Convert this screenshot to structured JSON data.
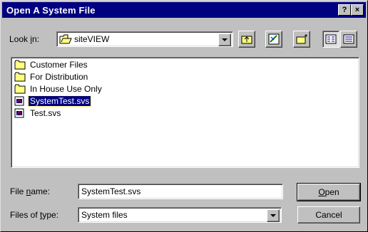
{
  "title": "Open A System File",
  "title_buttons": {
    "help": "?",
    "close": "×"
  },
  "look_in": {
    "label_pre": "Look ",
    "label_u": "i",
    "label_post": "n:",
    "value": "siteVIEW"
  },
  "toolbar": [
    "up-one-level-icon",
    "desktop-icon",
    "new-folder-icon",
    "list-view-icon",
    "details-view-icon"
  ],
  "files": [
    {
      "name": "Customer Files",
      "type": "folder",
      "selected": false
    },
    {
      "name": "For Distribution",
      "type": "folder",
      "selected": false
    },
    {
      "name": "In House Use Only",
      "type": "folder",
      "selected": false
    },
    {
      "name": "SystemTest.svs",
      "type": "system-file",
      "selected": true
    },
    {
      "name": "Test.svs",
      "type": "system-file",
      "selected": false
    }
  ],
  "file_name": {
    "label_pre": "File ",
    "label_u": "n",
    "label_post": "ame:",
    "value": "SystemTest.svs"
  },
  "files_of_type": {
    "label_pre": "Files of ",
    "label_u": "t",
    "label_post": "ype:",
    "value": "System files"
  },
  "buttons": {
    "open_u": "O",
    "open_rest": "pen",
    "cancel": "Cancel"
  },
  "colors": {
    "title_bar": "#000080",
    "dialog": "#c0c0c0",
    "selection": "#000080",
    "folder": "#ffff80"
  }
}
